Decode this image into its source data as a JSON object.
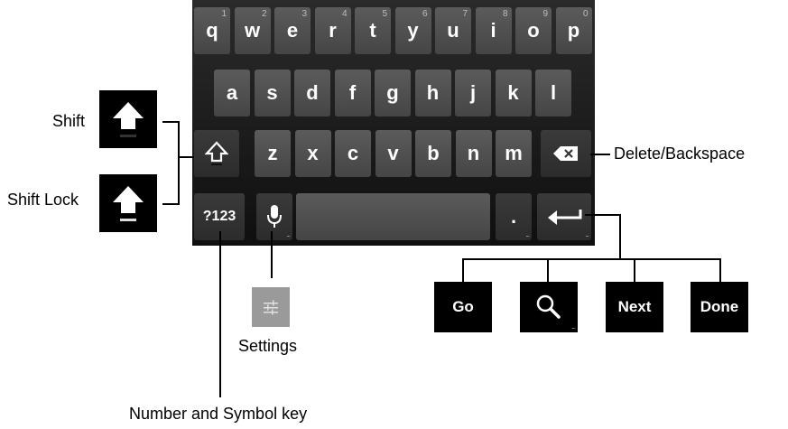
{
  "keyboard": {
    "row1": [
      {
        "key": "q",
        "hint": "1"
      },
      {
        "key": "w",
        "hint": "2"
      },
      {
        "key": "e",
        "hint": "3"
      },
      {
        "key": "r",
        "hint": "4"
      },
      {
        "key": "t",
        "hint": "5"
      },
      {
        "key": "y",
        "hint": "6"
      },
      {
        "key": "u",
        "hint": "7"
      },
      {
        "key": "i",
        "hint": "8"
      },
      {
        "key": "o",
        "hint": "9"
      },
      {
        "key": "p",
        "hint": "0"
      }
    ],
    "row2": [
      "a",
      "s",
      "d",
      "f",
      "g",
      "h",
      "j",
      "k",
      "l"
    ],
    "row3": [
      "z",
      "x",
      "c",
      "v",
      "b",
      "n",
      "m"
    ],
    "symbols_key": "?123",
    "period_key": "."
  },
  "callouts": {
    "shift": "Shift",
    "shift_lock": "Shift Lock",
    "delete": "Delete/Backspace",
    "settings": "Settings",
    "number_symbol": "Number and Symbol key"
  },
  "enter_variants": {
    "go": "Go",
    "next": "Next",
    "done": "Done"
  },
  "icons": [
    "shift-icon",
    "shift-lock-icon",
    "delete-icon",
    "mic-icon",
    "enter-icon",
    "search-icon",
    "settings-icon"
  ]
}
